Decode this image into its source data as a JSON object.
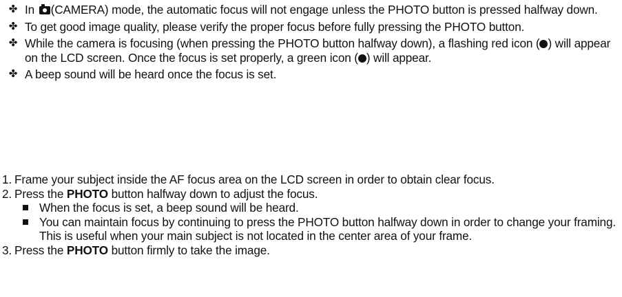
{
  "notes": [
    {
      "parts": [
        {
          "t": "text",
          "v": "In "
        },
        {
          "t": "icon",
          "name": "camera-icon"
        },
        {
          "t": "text",
          "v": "(CAMERA) mode, the automatic focus will not engage unless the PHOTO button is pressed halfway down."
        }
      ]
    },
    {
      "parts": [
        {
          "t": "text",
          "v": "To get good image quality, please verify the proper focus before fully pressing the PHOTO button."
        }
      ]
    },
    {
      "parts": [
        {
          "t": "text",
          "v": "While the camera is focusing (when pressing the PHOTO button halfway down), a flashing red icon ("
        },
        {
          "t": "icon",
          "name": "filled-circle-icon"
        },
        {
          "t": "text",
          "v": ") will appear on the LCD screen. Once the focus is set properly, a green icon ("
        },
        {
          "t": "icon",
          "name": "filled-circle-icon"
        },
        {
          "t": "text",
          "v": ") will appear."
        }
      ]
    },
    {
      "parts": [
        {
          "t": "text",
          "v": "A beep sound will be heard once the focus is set."
        }
      ]
    }
  ],
  "steps": [
    {
      "number": "1.",
      "parts": [
        {
          "t": "text",
          "v": "Frame your subject inside the AF focus area on the LCD screen in order to obtain clear focus."
        }
      ],
      "subitems": []
    },
    {
      "number": "2.",
      "parts": [
        {
          "t": "text",
          "v": "Press the "
        },
        {
          "t": "bold",
          "v": "PHOTO"
        },
        {
          "t": "text",
          "v": " button halfway down to adjust the focus."
        }
      ],
      "subitems": [
        "When the focus is set, a beep sound will be heard.",
        "You can maintain focus by continuing to press the PHOTO button halfway down in order to change your framing. This is useful when your main subject is not located in the center area of your frame."
      ]
    },
    {
      "number": "3.",
      "parts": [
        {
          "t": "text",
          "v": "Press the "
        },
        {
          "t": "bold",
          "v": "PHOTO"
        },
        {
          "t": "text",
          "v": " button firmly to take the image."
        }
      ],
      "subitems": []
    }
  ],
  "bullet_glyph": "✤"
}
